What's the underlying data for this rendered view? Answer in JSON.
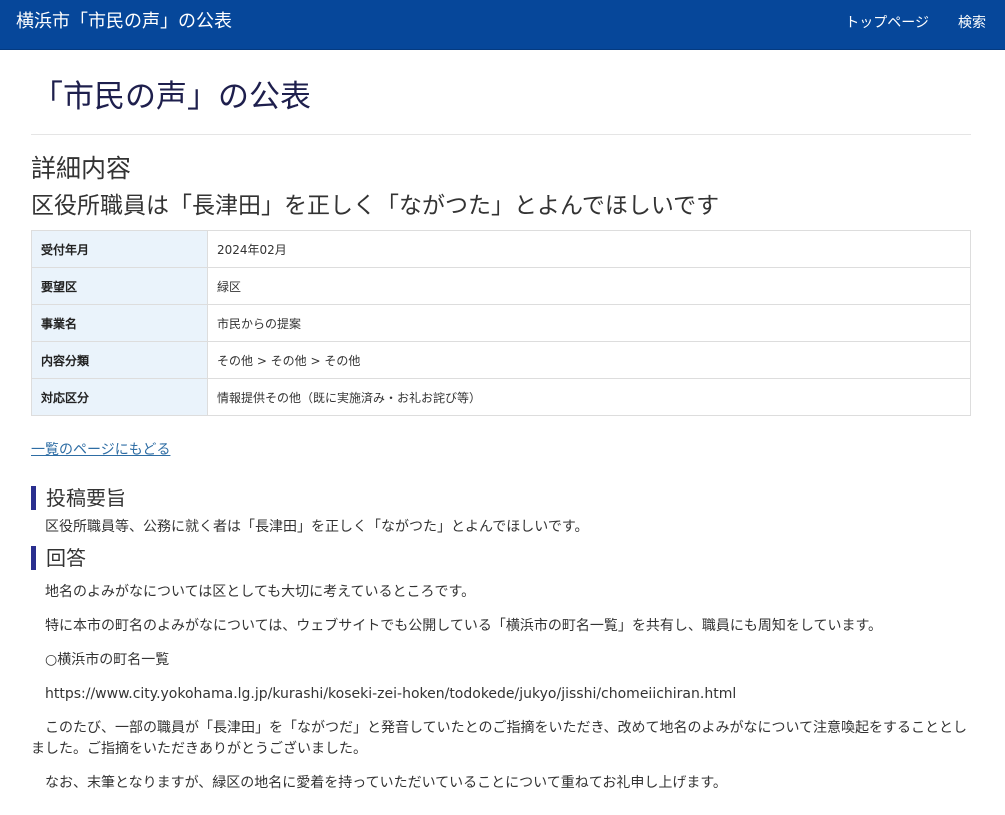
{
  "header": {
    "brand": "横浜市「市民の声」の公表",
    "nav": [
      "トップページ",
      "検索"
    ]
  },
  "page_title": "「市民の声」の公表",
  "section_title": "詳細内容",
  "item_title": "区役所職員は「長津田」を正しく「ながつた」とよんでほしいです",
  "details": [
    {
      "label": "受付年月",
      "value": "2024年02月"
    },
    {
      "label": "要望区",
      "value": "緑区"
    },
    {
      "label": "事業名",
      "value": "市民からの提案"
    },
    {
      "label": "内容分類",
      "value": "その他 > その他 > その他"
    },
    {
      "label": "対応区分",
      "value": "情報提供その他（既に実施済み・お礼お詫び等）"
    }
  ],
  "back_link": "一覧のページにもどる",
  "gist": {
    "heading": "投稿要旨",
    "text": "区役所職員等、公務に就く者は「長津田」を正しく「ながつた」とよんでほしいです。"
  },
  "answer": {
    "heading": "回答",
    "paragraphs": [
      "地名のよみがなについては区としても大切に考えているところです。",
      "特に本市の町名のよみがなについては、ウェブサイトでも公開している「横浜市の町名一覧」を共有し、職員にも周知をしています。",
      "○横浜市の町名一覧",
      "https://www.city.yokohama.lg.jp/kurashi/koseki-zei-hoken/todokede/jukyo/jisshi/chomeiichiran.html",
      "このたび、一部の職員が「長津田」を「ながつだ」と発音していたとのご指摘をいただき、改めて地名のよみがなについて注意喚起をすることとしました。ご指摘をいただきありがとうございました。",
      "なお、末筆となりますが、緑区の地名に愛着を持っていただいていることについて重ねてお礼申し上げます。"
    ]
  },
  "colors": {
    "header_bg": "#06479a",
    "title_text": "#1e1f4d",
    "table_label_bg": "#eaf3fb",
    "link": "#2e6da4",
    "heading_bar": "#2a2f8f"
  }
}
